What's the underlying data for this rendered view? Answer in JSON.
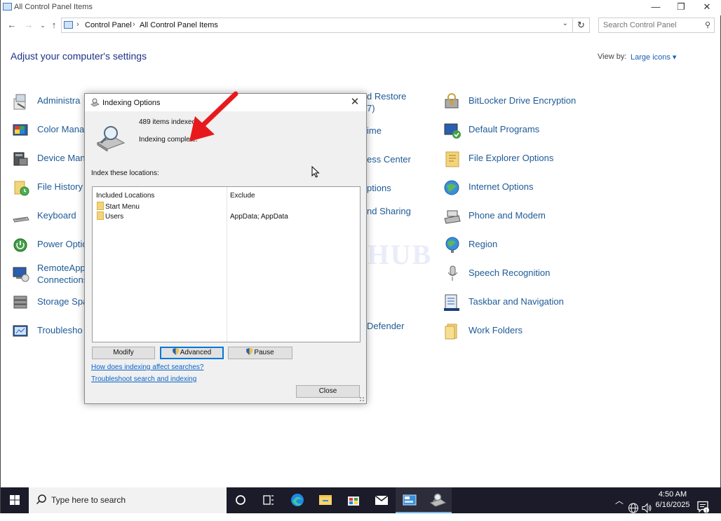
{
  "window": {
    "title": "All Control Panel Items",
    "controls": {
      "minimize": "—",
      "restore": "❐",
      "close": "✕"
    }
  },
  "addressbar": {
    "crumbs": [
      "Control Panel",
      "All Control Panel Items"
    ],
    "search_placeholder": "Search Control Panel"
  },
  "header": {
    "title": "Adjust your computer's settings",
    "view_by_label": "View by:",
    "view_by_value": "Large icons ▾"
  },
  "items": {
    "col1": [
      {
        "label": "Administra",
        "icon": "admin-tools-icon"
      },
      {
        "label": "Color Mana",
        "icon": "color-management-icon"
      },
      {
        "label": "Device Mana",
        "icon": "device-manager-icon"
      },
      {
        "label": "File History",
        "icon": "file-history-icon"
      },
      {
        "label": "Keyboard",
        "icon": "keyboard-icon"
      },
      {
        "label": "Power Optio",
        "icon": "power-options-icon"
      },
      {
        "label": "RemoteApp Connections",
        "icon": "remoteapp-icon"
      },
      {
        "label": "Storage Spa",
        "icon": "storage-spaces-icon"
      },
      {
        "label": "Troublesho",
        "icon": "troubleshooting-icon"
      }
    ],
    "col2": [
      {
        "label": "d Restore"
      },
      {
        "label": "7)"
      },
      {
        "label": "ime"
      },
      {
        "label": "ess Center"
      },
      {
        "label": "ptions"
      },
      {
        "label": "nd Sharing"
      },
      {
        "label": "Defender"
      }
    ],
    "col3": [
      {
        "label": "BitLocker Drive Encryption",
        "icon": "bitlocker-icon"
      },
      {
        "label": "Default Programs",
        "icon": "default-programs-icon"
      },
      {
        "label": "File Explorer Options",
        "icon": "file-explorer-options-icon"
      },
      {
        "label": "Internet Options",
        "icon": "internet-options-icon"
      },
      {
        "label": "Phone and Modem",
        "icon": "phone-modem-icon"
      },
      {
        "label": "Region",
        "icon": "region-icon"
      },
      {
        "label": "Speech Recognition",
        "icon": "speech-recognition-icon"
      },
      {
        "label": "Taskbar and Navigation",
        "icon": "taskbar-navigation-icon"
      },
      {
        "label": "Work Folders",
        "icon": "work-folders-icon"
      }
    ]
  },
  "watermark": "IT Pros HUB",
  "dialog": {
    "title": "Indexing Options",
    "items_indexed": "489 items indexed",
    "status": "Indexing complete.",
    "locations_label": "Index these locations:",
    "columns": {
      "included": "Included Locations",
      "exclude": "Exclude"
    },
    "locations": [
      {
        "name": "Start Menu",
        "exclude": ""
      },
      {
        "name": "Users",
        "exclude": "AppData; AppData"
      }
    ],
    "buttons": {
      "modify": "Modify",
      "advanced": "Advanced",
      "pause": "Pause",
      "close": "Close"
    },
    "links": {
      "affect": "How does indexing affect searches?",
      "troubleshoot": "Troubleshoot search and indexing"
    }
  },
  "taskbar": {
    "search_placeholder": "Type here to search",
    "time": "4:50 AM",
    "date": "6/16/2025"
  },
  "colors": {
    "accent": "#0078d7",
    "link": "#1e5a96",
    "heading": "#1e3287",
    "annotation_arrow": "#e8191c",
    "taskbar": "#1b1b2a"
  }
}
